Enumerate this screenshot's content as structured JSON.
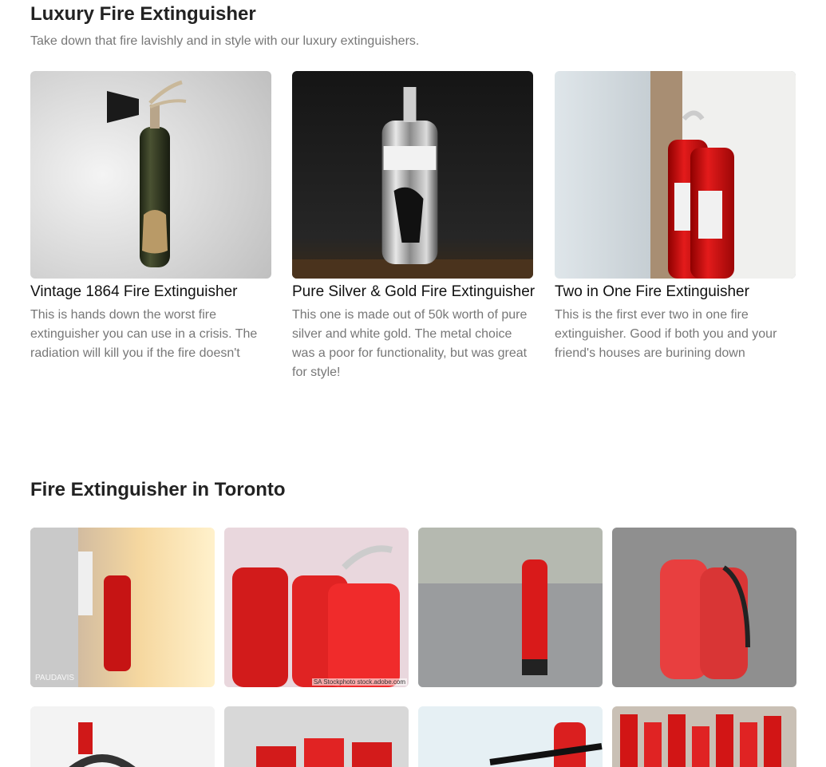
{
  "luxury": {
    "title": "Luxury Fire Extinguisher",
    "subtitle": "Take down that fire lavishly and in style with our luxury extinguishers.",
    "products": [
      {
        "title": "Vintage 1864 Fire Extinguisher",
        "description": "This is hands down the worst fire extinguisher you can use in a crisis. The radiation will kill you if the fire doesn't"
      },
      {
        "title": "Pure Silver & Gold Fire Extinguisher",
        "description": "This one is made out of 50k worth of pure silver and white gold. The metal choice was a poor for functionality, but was great for style!"
      },
      {
        "title": "Two in One Fire Extinguisher",
        "description": "This is the first ever two in one fire extinguisher. Good if both you and your friend's houses are burining down"
      }
    ]
  },
  "toronto": {
    "title": "Fire Extinguisher in Toronto",
    "watermarks": {
      "paudavis": "PAUDAVIS",
      "adobe": "SA Stockphoto stock.adobe.com"
    }
  }
}
